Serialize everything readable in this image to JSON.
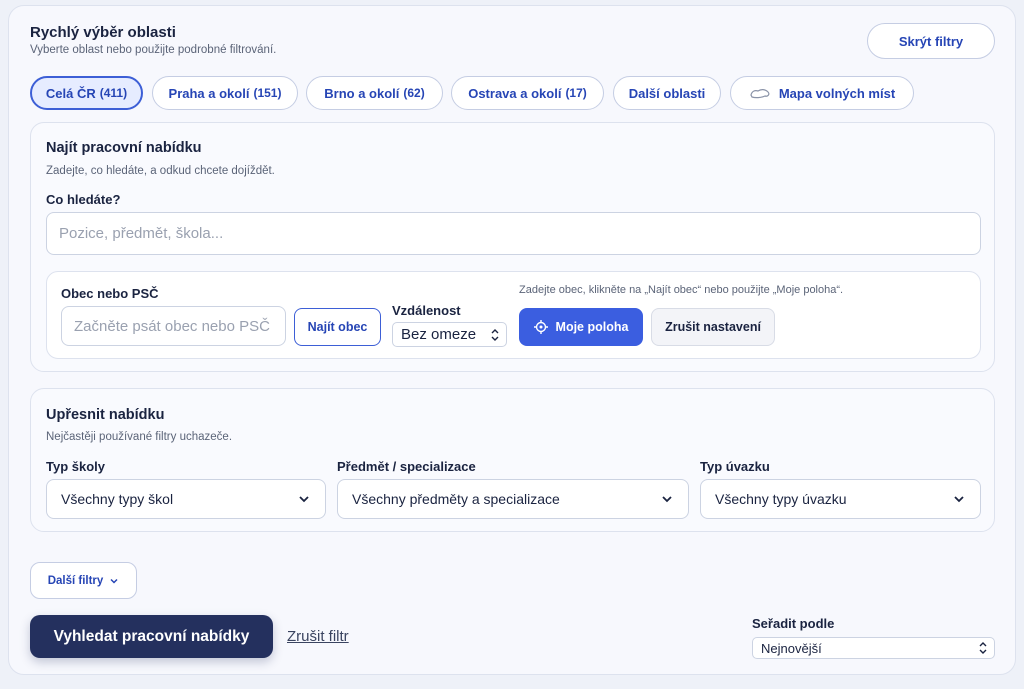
{
  "quick_area": {
    "title": "Rychlý výběr oblasti",
    "subtitle": "Vyberte oblast nebo použijte podrobné filtrování.",
    "hide_filters": "Skrýt filtry",
    "pills": [
      {
        "label": "Celá ČR",
        "count": "(411)"
      },
      {
        "label": "Praha a okolí",
        "count": "(151)"
      },
      {
        "label": "Brno a okolí",
        "count": "(62)"
      },
      {
        "label": "Ostrava a okolí",
        "count": "(17)"
      },
      {
        "label": "Další oblasti",
        "count": ""
      },
      {
        "label": "Mapa volných míst",
        "count": ""
      }
    ]
  },
  "find_job": {
    "title": "Najít pracovní nabídku",
    "subtitle": "Zadejte, co hledáte, a odkud chcete dojíždět.",
    "what_label": "Co hledáte?",
    "what_placeholder": "Pozice, předmět, škola..."
  },
  "location": {
    "label": "Obec nebo PSČ",
    "placeholder": "Začněte psát obec nebo PSČ",
    "find_button": "Najít obec",
    "distance_label": "Vzdálenost",
    "distance_value": "Bez omeze",
    "hint": "Zadejte obec, klikněte na „Najít obec“ nebo použijte „Moje poloha“.",
    "my_location": "Moje poloha",
    "reset": "Zrušit nastavení"
  },
  "refine": {
    "title": "Upřesnit nabídku",
    "subtitle": "Nejčastěji používané filtry uchazeče.",
    "school_label": "Typ školy",
    "school_value": "Všechny typy škol",
    "subject_label": "Předmět / specializace",
    "subject_value": "Všechny předměty a specializace",
    "contract_label": "Typ úvazku",
    "contract_value": "Všechny typy úvazku"
  },
  "footer": {
    "more_filters": "Další filtry",
    "search_button": "Vyhledat pracovní nabídky",
    "clear_filter": "Zrušit filtr",
    "sort_label": "Seřadit podle",
    "sort_value": "Nejnovější"
  },
  "colors": {
    "primary": "#3b5ee0",
    "dark_button": "#24305e",
    "link": "#2645b5"
  }
}
